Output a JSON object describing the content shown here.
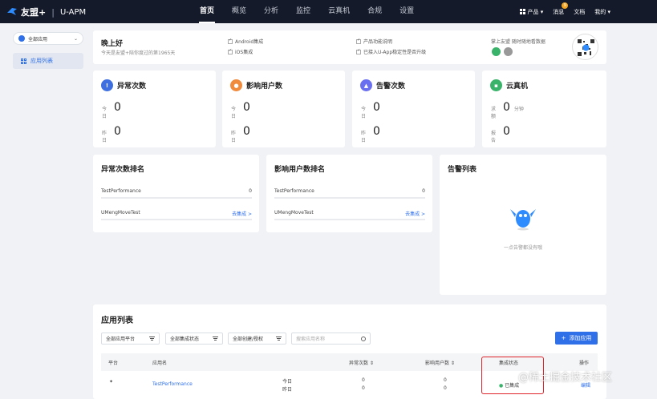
{
  "topbar": {
    "brand": "友盟+",
    "product": "U-APM",
    "nav": [
      "首页",
      "概览",
      "分析",
      "监控",
      "云真机",
      "合规",
      "设置"
    ],
    "active_nav": "首页",
    "right": {
      "products": "产品",
      "messages": "消息",
      "message_badge": "9",
      "docs": "文档",
      "me": "我的"
    }
  },
  "sidebar": {
    "app_select": "全部应用",
    "items": [
      {
        "label": "应用列表",
        "active": true
      }
    ]
  },
  "welcome": {
    "greeting": "晚上好",
    "sub": "今天是友盟+陪你度过的第1965天",
    "checks": [
      "Android集成",
      "iOS集成",
      "产品功能说明",
      "已接入U-App稳定性是否升级"
    ],
    "right_text": "掌上友盟 随时随地看数据"
  },
  "stats": [
    {
      "title": "异常次数",
      "icon": "warning-icon",
      "color": "#3d6fe0",
      "rows": [
        {
          "label": "今日",
          "value": "0",
          "unit": ""
        },
        {
          "label": "昨日",
          "value": "0",
          "unit": ""
        }
      ]
    },
    {
      "title": "影响用户数",
      "icon": "user-icon",
      "color": "#f08a3c",
      "rows": [
        {
          "label": "今日",
          "value": "0",
          "unit": ""
        },
        {
          "label": "昨日",
          "value": "0",
          "unit": ""
        }
      ]
    },
    {
      "title": "告警次数",
      "icon": "bell-icon",
      "color": "#6a6ff0",
      "rows": [
        {
          "label": "今日",
          "value": "0",
          "unit": ""
        },
        {
          "label": "昨日",
          "value": "0",
          "unit": ""
        }
      ]
    },
    {
      "title": "云真机",
      "icon": "device-icon",
      "color": "#3ab36a",
      "rows": [
        {
          "label": "求额",
          "value": "0",
          "unit": "分钟"
        },
        {
          "label": "报告",
          "value": "0",
          "unit": ""
        }
      ]
    }
  ],
  "rank_exception": {
    "title": "异常次数排名",
    "rows": [
      {
        "name": "TestPerformance",
        "value": "0",
        "link": ""
      },
      {
        "name": "UMengMoveTest",
        "value": "",
        "link": "去集成 >"
      }
    ]
  },
  "rank_users": {
    "title": "影响用户数排名",
    "rows": [
      {
        "name": "TestPerformance",
        "value": "0",
        "link": ""
      },
      {
        "name": "UMengMoveTest",
        "value": "",
        "link": "去集成 >"
      }
    ]
  },
  "alarm": {
    "title": "告警列表",
    "empty": "一点告警都没有哦"
  },
  "applist": {
    "title": "应用列表",
    "filters": [
      "全部应用平台",
      "全部集成状态",
      "全部创建/授权"
    ],
    "search_placeholder": "搜索应用名称",
    "add_button": "添加应用",
    "columns": [
      "平台",
      "应用名",
      "异常次数",
      "影响用户数",
      "集成状态",
      "操作"
    ],
    "row": {
      "name": "TestPerformance",
      "today": "今日",
      "yesterday": "昨日",
      "exc_today": "0",
      "exc_yesterday": "0",
      "users_today": "0",
      "users_yesterday": "0",
      "status": "已集成",
      "action": "编辑"
    }
  },
  "watermark": "@稀土掘金技术社区",
  "colors": {
    "accent": "#2f6fe8",
    "topbar": "#141a2a",
    "highlight": "#e0242c"
  }
}
